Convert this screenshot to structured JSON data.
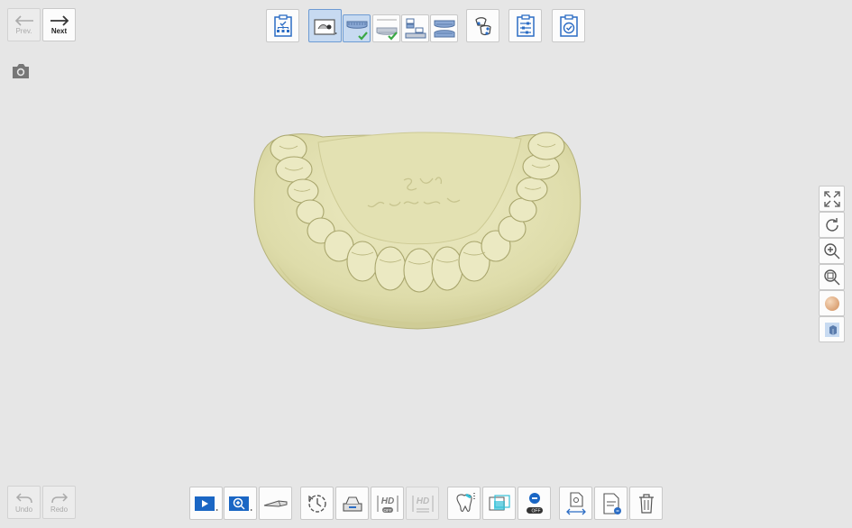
{
  "nav": {
    "prev_label": "Prev.",
    "next_label": "Next",
    "undo_label": "Undo",
    "redo_label": "Redo"
  },
  "top_toolbar": {
    "icons": [
      "workflow-icon",
      "scan-stage-icon",
      "lower-jaw-icon",
      "upper-jaw-icon",
      "articulation-icon",
      "occlusion-icon",
      "align-icon",
      "settings-icon",
      "complete-icon"
    ]
  },
  "bottom_toolbar": {
    "hd_label": "HD",
    "off_label": "OFF",
    "icons": [
      "play-scan-icon",
      "zoom-scan-icon",
      "scan-tip-icon",
      "history-icon",
      "scanner-icon",
      "hd-off-icon",
      "hd-dim-icon",
      "tooth-icon",
      "viewport-icon",
      "toggle-off-icon",
      "export-icon",
      "file-note-icon",
      "trash-icon"
    ]
  },
  "side_toolbar": {
    "icons": [
      "fit-screen-icon",
      "rotate-icon",
      "zoom-in-icon",
      "zoom-fit-icon",
      "texture-sphere-icon",
      "view-mode-icon"
    ]
  },
  "model": {
    "name": "lower-dental-arch",
    "engraving": "Sbth Van Boogaert",
    "color": "#e5e2b6"
  },
  "colors": {
    "background": "#e6e6e6",
    "accent": "#1a66c4",
    "check": "#3aa845"
  }
}
